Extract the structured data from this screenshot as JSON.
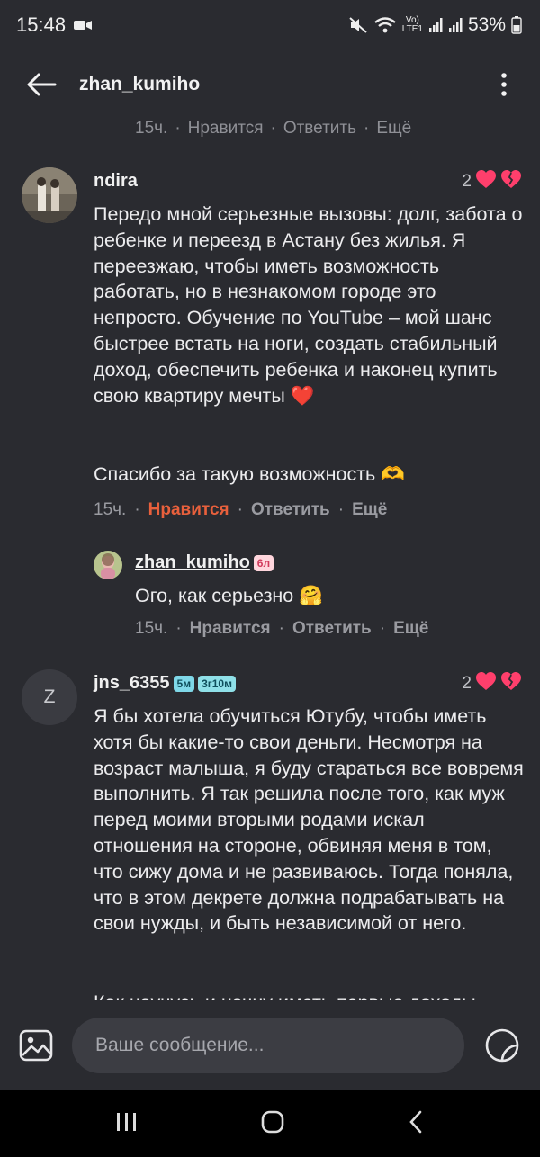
{
  "status": {
    "time": "15:48",
    "battery": "53%",
    "network": "LTE1"
  },
  "header": {
    "title": "zhan_kumiho"
  },
  "top_fragment": {
    "time": "15ч.",
    "like": "Нравится",
    "reply": "Ответить",
    "more": "Ещё"
  },
  "comments": [
    {
      "author": "ndira",
      "likes": "2",
      "paragraphs": [
        "Передо мной серьезные вызовы: долг, забота о ребенке и переезд в Астану без жилья. Я переезжаю, чтобы иметь возможность работать, но в незнакомом городе это непросто. Обучение по YouTube – мой шанс быстрее встать на ноги, создать стабильный доход, обеспечить ребенка и наконец купить свою квартиру мечты ❤️",
        "Спасибо за такую возможность 🫶"
      ],
      "time": "15ч.",
      "like": "Нравится",
      "reply": "Ответить",
      "more": "Ещё"
    },
    {
      "author": "jns_6355",
      "badge1": "5м",
      "badge2": "3г10м",
      "likes": "2",
      "avatar_letter": "Z",
      "paragraphs": [
        "Я бы хотела обучиться Ютубу, чтобы иметь хотя бы какие-то свои деньги. Несмотря на возраст малыша, я буду стараться все вовремя выполнить. Я так решила после того, как муж перед моими вторыми родами искал отношения на стороне, обвиняя меня в том, что сижу дома и не развиваюсь. Тогда поняла, что в этом декрете должна подрабатывать на свои нужды, и быть независимой от него.",
        "Как научусь и начну иметь первые доходы"
      ]
    }
  ],
  "reply": {
    "author": "zhan_kumiho",
    "badge": "6л",
    "text": "Ого, как серьезно 🤗",
    "time": "15ч.",
    "like": "Нравится",
    "reply": "Ответить",
    "more": "Ещё"
  },
  "composer": {
    "placeholder": "Ваше сообщение..."
  },
  "colors": {
    "background": "#2a2b30",
    "liked": "#e8603c",
    "heart": "#ff3f6c"
  }
}
